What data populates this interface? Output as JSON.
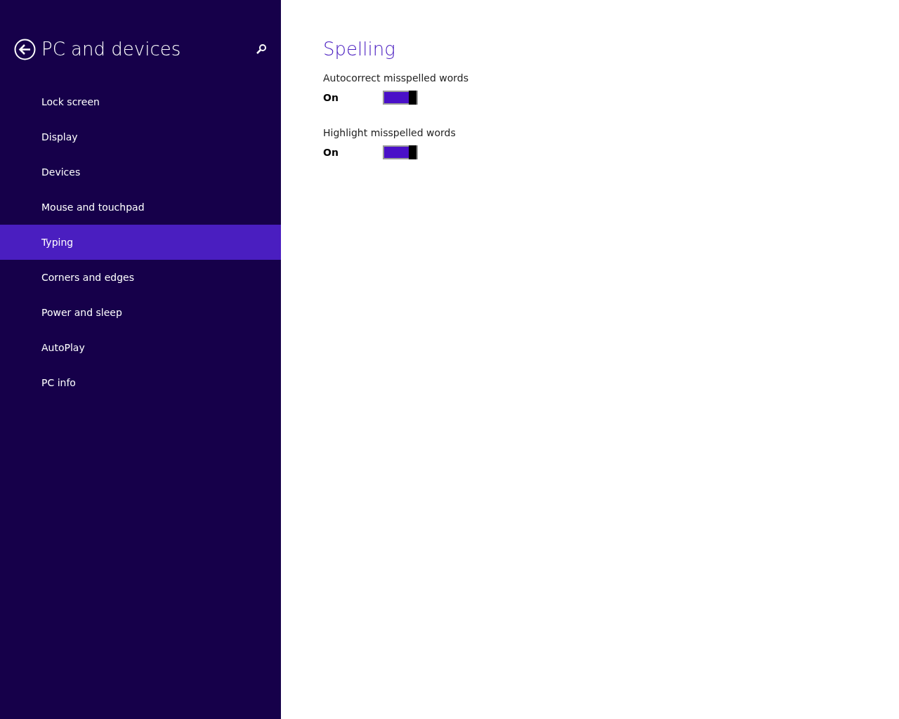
{
  "sidebar": {
    "title": "PC and devices",
    "items": [
      {
        "label": "Lock screen",
        "selected": false
      },
      {
        "label": "Display",
        "selected": false
      },
      {
        "label": "Devices",
        "selected": false
      },
      {
        "label": "Mouse and touchpad",
        "selected": false
      },
      {
        "label": "Typing",
        "selected": true
      },
      {
        "label": "Corners and edges",
        "selected": false
      },
      {
        "label": "Power and sleep",
        "selected": false
      },
      {
        "label": "AutoPlay",
        "selected": false
      },
      {
        "label": "PC info",
        "selected": false
      }
    ]
  },
  "content": {
    "heading": "Spelling",
    "settings": [
      {
        "label": "Autocorrect misspelled words",
        "state_text": "On",
        "on": true
      },
      {
        "label": "Highlight misspelled words",
        "state_text": "On",
        "on": true
      }
    ]
  }
}
